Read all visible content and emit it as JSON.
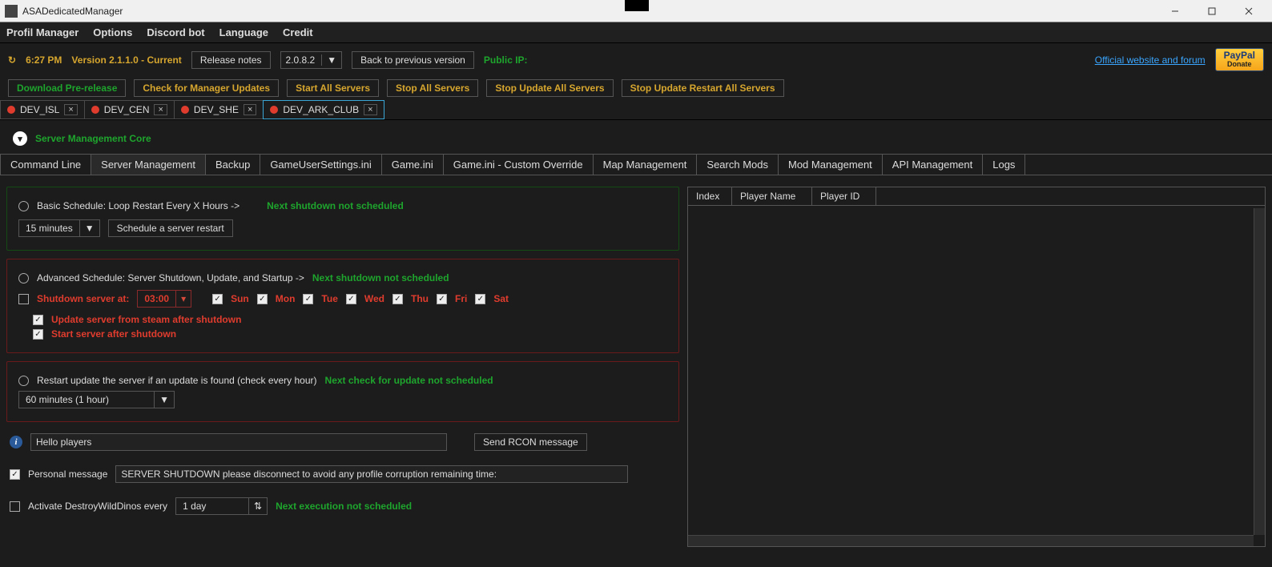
{
  "window": {
    "title": "ASADedicatedManager"
  },
  "menu": {
    "items": [
      "Profil Manager",
      "Options",
      "Discord bot",
      "Language",
      "Credit"
    ]
  },
  "info": {
    "refresh_glyph": "↻",
    "time": "6:27 PM",
    "version": "Version 2.1.1.0 - Current",
    "release_notes": "Release notes",
    "build_select": "2.0.8.2",
    "back_label": "Back to previous version",
    "public_ip_label": "Public IP:",
    "official_link": "Official website and forum",
    "paypal": "PayPal",
    "paypal_sub": "Donate"
  },
  "actions": {
    "download_pre": "Download Pre-release",
    "check_updates": "Check for Manager Updates",
    "start_all": "Start All Servers",
    "stop_all": "Stop All Servers",
    "stop_update_all": "Stop Update All Servers",
    "stop_update_restart_all": "Stop Update Restart All Servers"
  },
  "server_tabs": [
    {
      "name": "DEV_ISL",
      "active": false
    },
    {
      "name": "DEV_CEN",
      "active": false
    },
    {
      "name": "DEV_SHE",
      "active": false
    },
    {
      "name": "DEV_ARK_CLUB",
      "active": true
    }
  ],
  "section": {
    "title": "Server Management Core"
  },
  "subtabs": [
    "Command Line",
    "Server Management",
    "Backup",
    "GameUserSettings.ini",
    "Game.ini",
    "Game.ini - Custom Override",
    "Map Management",
    "Search Mods",
    "Mod Management",
    "API Management",
    "Logs"
  ],
  "subtab_active": 1,
  "basic": {
    "label": "Basic Schedule: Loop Restart Every X Hours ->",
    "status": "Next shutdown not scheduled",
    "interval": "15 minutes",
    "schedule_btn": "Schedule a server restart"
  },
  "adv": {
    "label": "Advanced Schedule: Server Shutdown, Update, and Startup ->",
    "status": "Next shutdown not scheduled",
    "shutdown_label": "Shutdown server at:",
    "shutdown_time": "03:00",
    "days": [
      "Sun",
      "Mon",
      "Tue",
      "Wed",
      "Thu",
      "Fri",
      "Sat"
    ],
    "update_after": "Update server from steam after shutdown",
    "start_after": "Start server after shutdown"
  },
  "restart": {
    "label": "Restart update the server if an update is found (check every hour)",
    "status": "Next check for update not scheduled",
    "interval": "60 minutes (1 hour)"
  },
  "rcon": {
    "input": "Hello players",
    "send": "Send RCON message"
  },
  "personal": {
    "label": "Personal message",
    "value": "SERVER SHUTDOWN please disconnect to avoid any profile corruption remaining time:"
  },
  "destroy": {
    "label": "Activate DestroyWildDinos every",
    "value": "1 day",
    "status": "Next execution not scheduled"
  },
  "players": {
    "cols": [
      "Index",
      "Player Name",
      "Player ID"
    ]
  }
}
